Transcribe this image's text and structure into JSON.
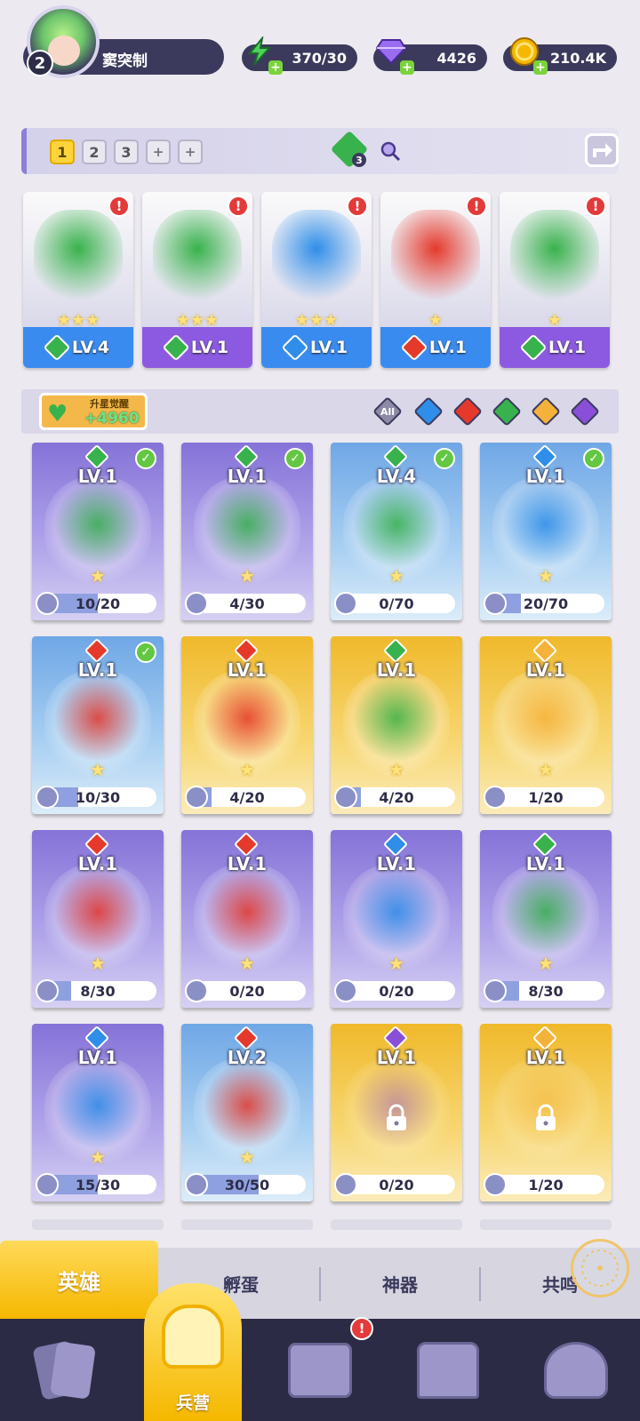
{
  "player": {
    "level": "2",
    "name": "窦突制"
  },
  "resources": [
    {
      "id": "energy",
      "value": "370/30",
      "icon": "lightning-icon",
      "color": "#4fd15a"
    },
    {
      "id": "gems",
      "value": "4426",
      "icon": "diamond-icon",
      "color": "#9a6cf0"
    },
    {
      "id": "gold",
      "value": "210.4K",
      "icon": "coin-icon",
      "color": "#f5b800"
    }
  ],
  "team_bar": {
    "tabs": [
      "1",
      "2",
      "3",
      "+",
      "+"
    ],
    "active_tab": "1",
    "gem_count": "3"
  },
  "team": [
    {
      "level": "LV.4",
      "stars": "★★★",
      "element": "wind",
      "color": "#3a8bf0"
    },
    {
      "level": "LV.1",
      "stars": "★★★",
      "element": "wind",
      "color": "#8c5ae0"
    },
    {
      "level": "LV.1",
      "stars": "★★★",
      "element": "water",
      "color": "#3a8bf0"
    },
    {
      "level": "LV.1",
      "stars": "★",
      "element": "fire",
      "color": "#3a8bf0"
    },
    {
      "level": "LV.1",
      "stars": "★",
      "element": "wind",
      "color": "#8c5ae0"
    }
  ],
  "filter": {
    "awaken_label": "升星觉醒",
    "awaken_count": "+4960",
    "all_label": "All",
    "elements": [
      "water",
      "fire",
      "wind",
      "light",
      "dark"
    ]
  },
  "heroes": [
    {
      "level": "LV.1",
      "progress": "10/20",
      "fraction": 0.5,
      "element": "wind",
      "checked": true,
      "theme": "purple",
      "locked": false
    },
    {
      "level": "LV.1",
      "progress": "4/30",
      "fraction": 0.13,
      "element": "wind",
      "checked": true,
      "theme": "purple",
      "locked": false
    },
    {
      "level": "LV.4",
      "progress": "0/70",
      "fraction": 0,
      "element": "wind",
      "checked": true,
      "theme": "blue",
      "locked": false
    },
    {
      "level": "LV.1",
      "progress": "20/70",
      "fraction": 0.29,
      "element": "water",
      "checked": true,
      "theme": "blue",
      "locked": false
    },
    {
      "level": "LV.1",
      "progress": "10/30",
      "fraction": 0.33,
      "element": "fire",
      "checked": true,
      "theme": "blue",
      "locked": false
    },
    {
      "level": "LV.1",
      "progress": "4/20",
      "fraction": 0.2,
      "element": "fire",
      "checked": false,
      "theme": "gold",
      "locked": false
    },
    {
      "level": "LV.1",
      "progress": "4/20",
      "fraction": 0.2,
      "element": "wind",
      "checked": false,
      "theme": "gold",
      "locked": false
    },
    {
      "level": "LV.1",
      "progress": "1/20",
      "fraction": 0.05,
      "element": "light",
      "checked": false,
      "theme": "gold",
      "locked": false
    },
    {
      "level": "LV.1",
      "progress": "8/30",
      "fraction": 0.27,
      "element": "fire",
      "checked": false,
      "theme": "purple",
      "locked": false
    },
    {
      "level": "LV.1",
      "progress": "0/20",
      "fraction": 0,
      "element": "fire",
      "checked": false,
      "theme": "purple",
      "locked": false
    },
    {
      "level": "LV.1",
      "progress": "0/20",
      "fraction": 0,
      "element": "water",
      "checked": false,
      "theme": "purple",
      "locked": false
    },
    {
      "level": "LV.1",
      "progress": "8/30",
      "fraction": 0.27,
      "element": "wind",
      "checked": false,
      "theme": "purple",
      "locked": false
    },
    {
      "level": "LV.1",
      "progress": "15/30",
      "fraction": 0.5,
      "element": "water",
      "checked": false,
      "theme": "purple",
      "locked": false
    },
    {
      "level": "LV.2",
      "progress": "30/50",
      "fraction": 0.6,
      "element": "fire",
      "checked": false,
      "theme": "blue",
      "locked": false
    },
    {
      "level": "LV.1",
      "progress": "0/20",
      "fraction": 0,
      "element": "dark",
      "checked": false,
      "theme": "gold",
      "locked": true
    },
    {
      "level": "LV.1",
      "progress": "1/20",
      "fraction": 0.05,
      "element": "light",
      "checked": false,
      "theme": "gold",
      "locked": true
    }
  ],
  "bottom_tabs": [
    "英雄",
    "孵蛋",
    "神器",
    "共鸣"
  ],
  "active_bottom_tab": "英雄",
  "nav": {
    "items": [
      "cards-icon",
      "barracks-icon",
      "map-icon",
      "shop-icon",
      "guild-icon"
    ],
    "active_label": "兵营",
    "alert": "!"
  },
  "colors": {
    "wind": "#38b24c",
    "water": "#2f8ee8",
    "fire": "#e5392c",
    "light": "#f5b23b",
    "dark": "#8a4fd8",
    "purple": "#8a7ad8",
    "blue": "#7fb4e8",
    "gold": "#f0c040"
  }
}
